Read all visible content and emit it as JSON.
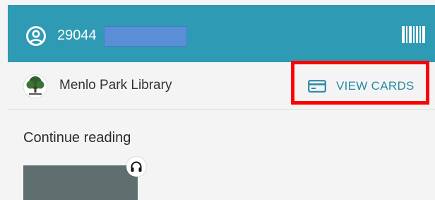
{
  "header": {
    "account_number": "29044",
    "icons": {
      "account": "account-circle-icon",
      "barcode": "barcode-icon"
    },
    "bg_color": "#2e9ab3"
  },
  "library": {
    "name": "Menlo Park Library",
    "view_cards_label": "VIEW CARDS",
    "accent_color": "#2b8aa3",
    "icons": {
      "logo": "library-tree-logo",
      "card": "card-icon"
    }
  },
  "continue_reading": {
    "title": "Continue reading",
    "items": [
      {
        "format_icon": "headphones-icon"
      }
    ]
  },
  "highlight_color": "#ff0000"
}
